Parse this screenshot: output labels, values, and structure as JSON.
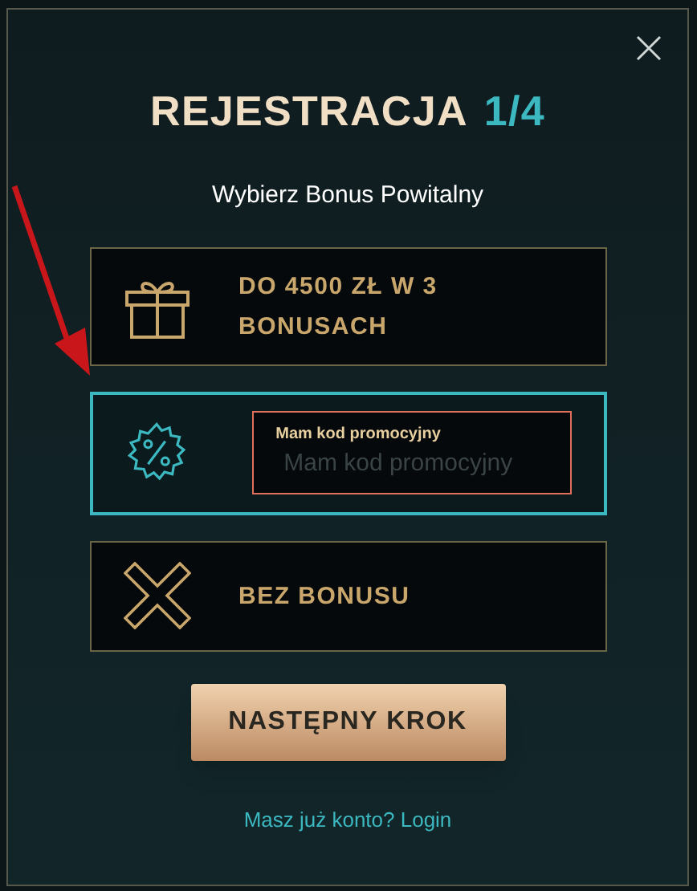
{
  "dialog": {
    "title": "REJESTRACJA",
    "step": "1/4",
    "subtitle": "Wybierz Bonus Powitalny"
  },
  "options": [
    {
      "kind": "gift",
      "label": "DO 4500 ZŁ W 3 BONUSACH",
      "selected": false
    },
    {
      "kind": "promo",
      "field_label": "Mam kod promocyjny",
      "placeholder": "Mam kod promocyjny",
      "selected": true
    },
    {
      "kind": "none",
      "label": "BEZ BONUSU",
      "selected": false
    }
  ],
  "next_button": "NASTĘPNY KROK",
  "login_link": "Masz już konto? Login"
}
